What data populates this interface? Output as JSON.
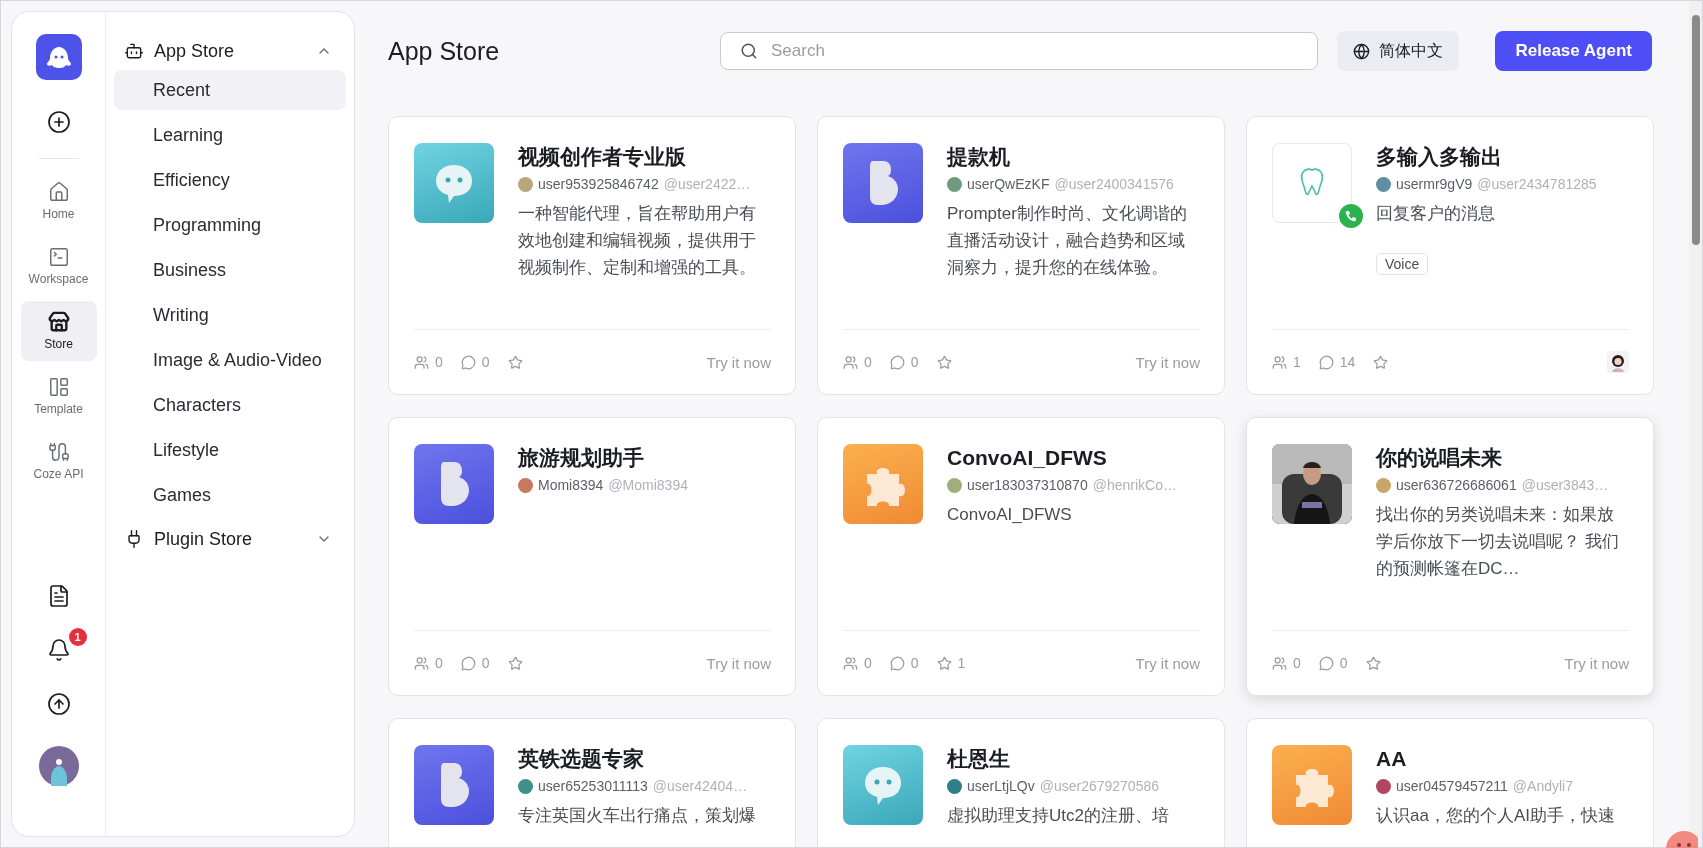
{
  "rail": {
    "nav": [
      {
        "label": "Home",
        "selected": false
      },
      {
        "label": "Workspace",
        "selected": false
      },
      {
        "label": "Store",
        "selected": true
      },
      {
        "label": "Template",
        "selected": false
      },
      {
        "label": "Coze API",
        "selected": false
      }
    ],
    "notifications_badge": "1"
  },
  "sidebar": {
    "groups": [
      {
        "label": "App Store",
        "expanded": true,
        "items": [
          {
            "label": "Recent",
            "selected": true
          },
          {
            "label": "Learning",
            "selected": false
          },
          {
            "label": "Efficiency",
            "selected": false
          },
          {
            "label": "Programming",
            "selected": false
          },
          {
            "label": "Business",
            "selected": false
          },
          {
            "label": "Writing",
            "selected": false
          },
          {
            "label": "Image & Audio-Video",
            "selected": false
          },
          {
            "label": "Characters",
            "selected": false
          },
          {
            "label": "Lifestyle",
            "selected": false
          },
          {
            "label": "Games",
            "selected": false
          }
        ]
      },
      {
        "label": "Plugin Store",
        "expanded": false
      }
    ]
  },
  "header": {
    "title": "App Store",
    "search": {
      "placeholder": "Search"
    },
    "language": "简体中文",
    "release_button": "Release Agent"
  },
  "cards": [
    {
      "kind": "chat",
      "title": "视频创作者专业版",
      "author": "user953925846742",
      "handle": "@user2422…",
      "color": "#b7a77a",
      "description": "一种智能代理，旨在帮助用户有效地创建和编辑视频，提供用于视频制作、定制和增强的工具。",
      "users": "0",
      "comments": "0",
      "hovered": false,
      "footer": {
        "kind": "link",
        "label": "Try it now"
      }
    },
    {
      "kind": "b",
      "title": "提款机",
      "author": "userQwEzKF",
      "handle": "@user2400341576",
      "color": "#6f9a7c",
      "description": "Prompter制作时尚、文化调谐的直播活动设计，融合趋势和区域洞察力，提升您的在线体验。",
      "users": "0",
      "comments": "0",
      "hovered": false,
      "footer": {
        "kind": "link",
        "label": "Try it now"
      }
    },
    {
      "kind": "tooth",
      "title": "多输入多输出",
      "author": "usermr9gV9",
      "handle": "@user2434781285",
      "color": "#5f8fa0",
      "description": "回复客户的消息",
      "tags": [
        "Voice"
      ],
      "users": "1",
      "comments": "14",
      "hovered": false,
      "footer": {
        "kind": "avatar"
      }
    },
    {
      "kind": "b",
      "title": "旅游规划助手",
      "author": "Momi8394",
      "handle": "@Momi8394",
      "color": "#c9785e",
      "users": "0",
      "comments": "0",
      "hovered": false,
      "footer": {
        "kind": "link",
        "label": "Try it now"
      }
    },
    {
      "kind": "puzzle",
      "title": "ConvoAI_DFWS",
      "author": "user183037310870",
      "handle": "@henrikCo…",
      "color": "#9fae7a",
      "description": "ConvoAI_DFWS",
      "users": "0",
      "comments": "0",
      "favorites": "1",
      "hovered": false,
      "footer": {
        "kind": "link",
        "label": "Try it now"
      }
    },
    {
      "kind": "picture",
      "title": "你的说唱未来",
      "author": "user636726686061",
      "handle": "@user3843…",
      "color": "#c9a66b",
      "description": "找出你的另类说唱未来：如果放学后你放下一切去说唱呢？ 我们的预测帐篷在DC…",
      "users": "0",
      "comments": "0",
      "hovered": true,
      "footer": {
        "kind": "link",
        "label": "Try it now"
      }
    },
    {
      "kind": "b",
      "title": "英铁选题专家",
      "author": "user65253011113",
      "handle": "@user42404…",
      "color": "#3f8f8a",
      "description": "专注英国火车出行痛点，策划爆",
      "hovered": false
    },
    {
      "kind": "chat",
      "title": "杜恩生",
      "author": "userLtjLQv",
      "handle": "@user2679270586",
      "color": "#2f7f8a",
      "description": "虚拟助理支持Utc2的注册、培",
      "hovered": false
    },
    {
      "kind": "puzzle",
      "title": "AA",
      "author": "user04579457211",
      "handle": "@Andyli7",
      "color": "#b0475e",
      "description": "认识aa，您的个人AI助手，快速",
      "hovered": false
    }
  ]
}
